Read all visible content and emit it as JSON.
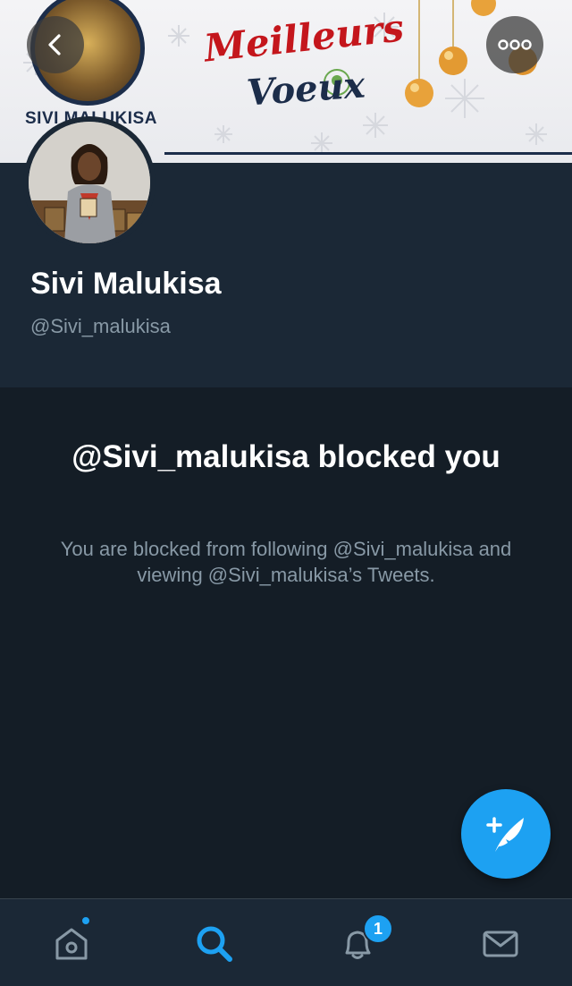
{
  "banner": {
    "title_line1": "Meilleurs",
    "title_line2": "Voeux",
    "shop_name": "SIVI MALUKISA"
  },
  "profile": {
    "display_name": "Sivi Malukisa",
    "handle": "@Sivi_malukisa"
  },
  "blocked": {
    "title": "@Sivi_malukisa blocked you",
    "message": "You are blocked from following @Sivi_malukisa and viewing @Sivi_malukisa’s Tweets."
  },
  "tabbar": {
    "notifications_count": "1",
    "active_tab": "search"
  },
  "colors": {
    "accent": "#1da1f2",
    "background": "#141d26",
    "panel": "#1b2836",
    "secondary_text": "#8899a6"
  },
  "icons": {
    "back": "chevron-left-icon",
    "more": "more-dots-icon",
    "compose": "compose-tweet-icon",
    "home": "home-icon",
    "search": "search-icon",
    "notifications": "bell-icon",
    "messages": "envelope-icon"
  }
}
